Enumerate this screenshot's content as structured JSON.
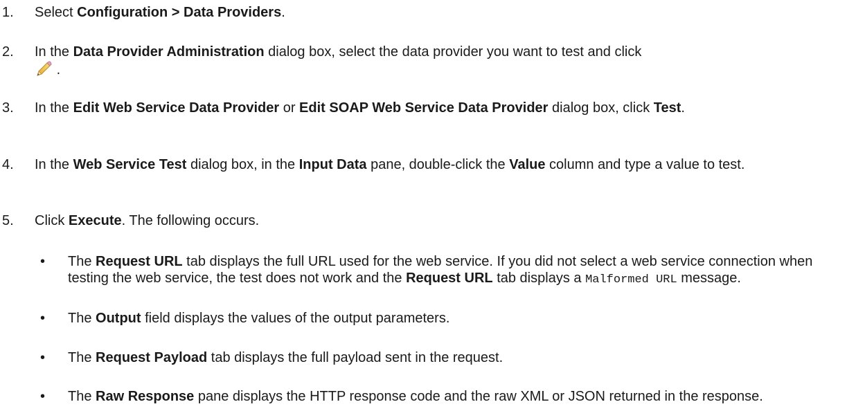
{
  "steps": [
    {
      "num": "1.",
      "t0": "Select ",
      "b0": "Configuration > Data Providers",
      "t1": "."
    },
    {
      "num": "2.",
      "t0": "In the ",
      "b0": "Data Provider Administration",
      "t1": " dialog box, select the data provider you want to test and click",
      "icon": "edit-pencil-icon",
      "t2": "."
    },
    {
      "num": "3.",
      "t0": "In the ",
      "b0": "Edit Web Service Data Provider",
      "t1": " or ",
      "b1": "Edit SOAP Web Service Data Provider",
      "t2": " dialog box, click ",
      "b2": "Test",
      "t3": "."
    },
    {
      "num": "4.",
      "t0": "In the ",
      "b0": "Web Service Test",
      "t1": " dialog box, in the ",
      "b1": "Input Data",
      "t2": " pane, double-click the ",
      "b2": "Value",
      "t3": " column and type a value to test."
    },
    {
      "num": "5.",
      "t0": "Click ",
      "b0": "Execute",
      "t1": ". The following occurs."
    }
  ],
  "bullets": [
    {
      "t0": "The ",
      "b0": "Request URL",
      "t1": " tab displays the full URL used for the web service. If you did not select a web service connection when testing the web service, the test does not work and the ",
      "b1": "Request URL",
      "t2": " tab displays a ",
      "code": "Malformed URL",
      "t3": " message."
    },
    {
      "t0": "The ",
      "b0": "Output",
      "t1": " field displays the values of the output parameters."
    },
    {
      "t0": "The ",
      "b0": "Request Payload",
      "t1": " tab displays the full payload sent in the request."
    },
    {
      "t0": "The ",
      "b0": "Raw Response",
      "t1": " pane displays the HTTP response code and the raw XML or JSON returned in the response."
    }
  ],
  "bullet_glyph": "•"
}
